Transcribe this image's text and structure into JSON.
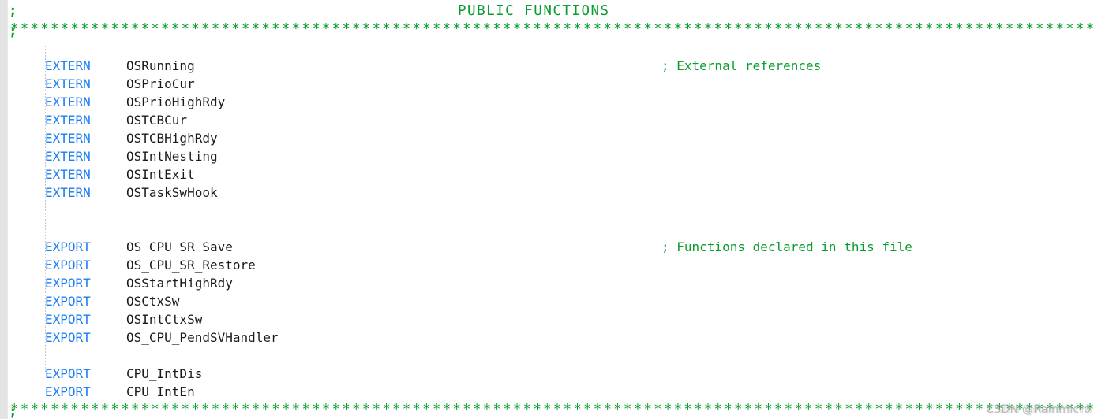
{
  "editor": {
    "language": "arm-assembly",
    "colors": {
      "keyword": "#1a7ef0",
      "identifier": "#1a1a1a",
      "comment": "#089d2e",
      "background": "#ffffff",
      "gutter": "#e3e3e3"
    }
  },
  "banner": {
    "leading_semicolon": ";",
    "title": "PUBLIC FUNCTIONS",
    "separator_char": "*",
    "separator_top": ";********************************************************************************************************************",
    "separator_bottom": ";********************************************************************************************************************"
  },
  "comments": {
    "external_references": "; External references",
    "functions_declared": "; Functions declared in this file"
  },
  "extern_block": {
    "keyword": "EXTERN",
    "symbols": [
      "OSRunning",
      "OSPrioCur",
      "OSPrioHighRdy",
      "OSTCBCur",
      "OSTCBHighRdy",
      "OSIntNesting",
      "OSIntExit",
      "OSTaskSwHook"
    ]
  },
  "export_block_os": {
    "keyword": "EXPORT",
    "symbols": [
      "OS_CPU_SR_Save",
      "OS_CPU_SR_Restore",
      "OSStartHighRdy",
      "OSCtxSw",
      "OSIntCtxSw",
      "OS_CPU_PendSVHandler"
    ]
  },
  "export_block_cpu": {
    "keyword": "EXPORT",
    "symbols": [
      "CPU_IntDis",
      "CPU_IntEn"
    ]
  },
  "watermark": {
    "text": "CSDN @Rainmicro"
  }
}
